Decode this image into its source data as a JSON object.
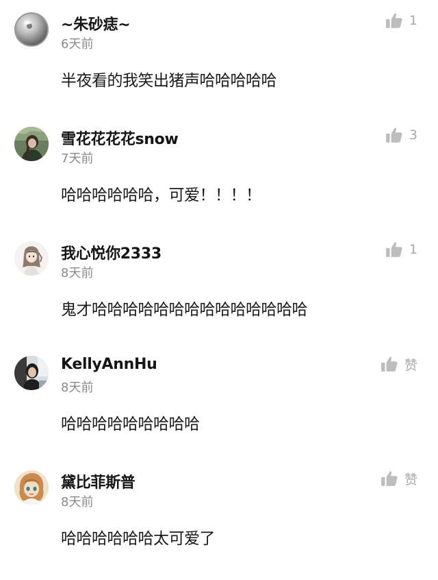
{
  "comments": [
    {
      "username": "~朱砂痣~",
      "time": "6天前",
      "content": "半夜看的我笑出猪声哈哈哈哈哈",
      "likes": "1",
      "avatar": "steel-ball-avatar"
    },
    {
      "username": "雪花花花花snow",
      "time": "7天前",
      "content": "哈哈哈哈哈哈，可爱！！！！",
      "likes": "3",
      "avatar": "girl-in-forest-avatar"
    },
    {
      "username": "我心悦你2333",
      "time": "8天前",
      "content": "鬼才哈哈哈哈哈哈哈哈哈哈哈哈哈哈",
      "likes": "1",
      "avatar": "anime-girl-sketch-avatar"
    },
    {
      "username": "KellyAnnHu",
      "time": "8天前",
      "content": "哈哈哈哈哈哈哈哈哈",
      "likes": "赞",
      "avatar": "woman-in-car-avatar"
    },
    {
      "username": "黛比菲斯普",
      "time": "8天前",
      "content": "哈哈哈哈哈哈太可爱了",
      "likes": "赞",
      "avatar": "cartoon-girl-avatar"
    }
  ],
  "colors": {
    "username": "#151515",
    "time": "#8a8a8a",
    "like_icon": "#bdbdbd",
    "like_count": "#a9a9a9"
  },
  "icons": {
    "like": "thumbs-up-icon"
  }
}
